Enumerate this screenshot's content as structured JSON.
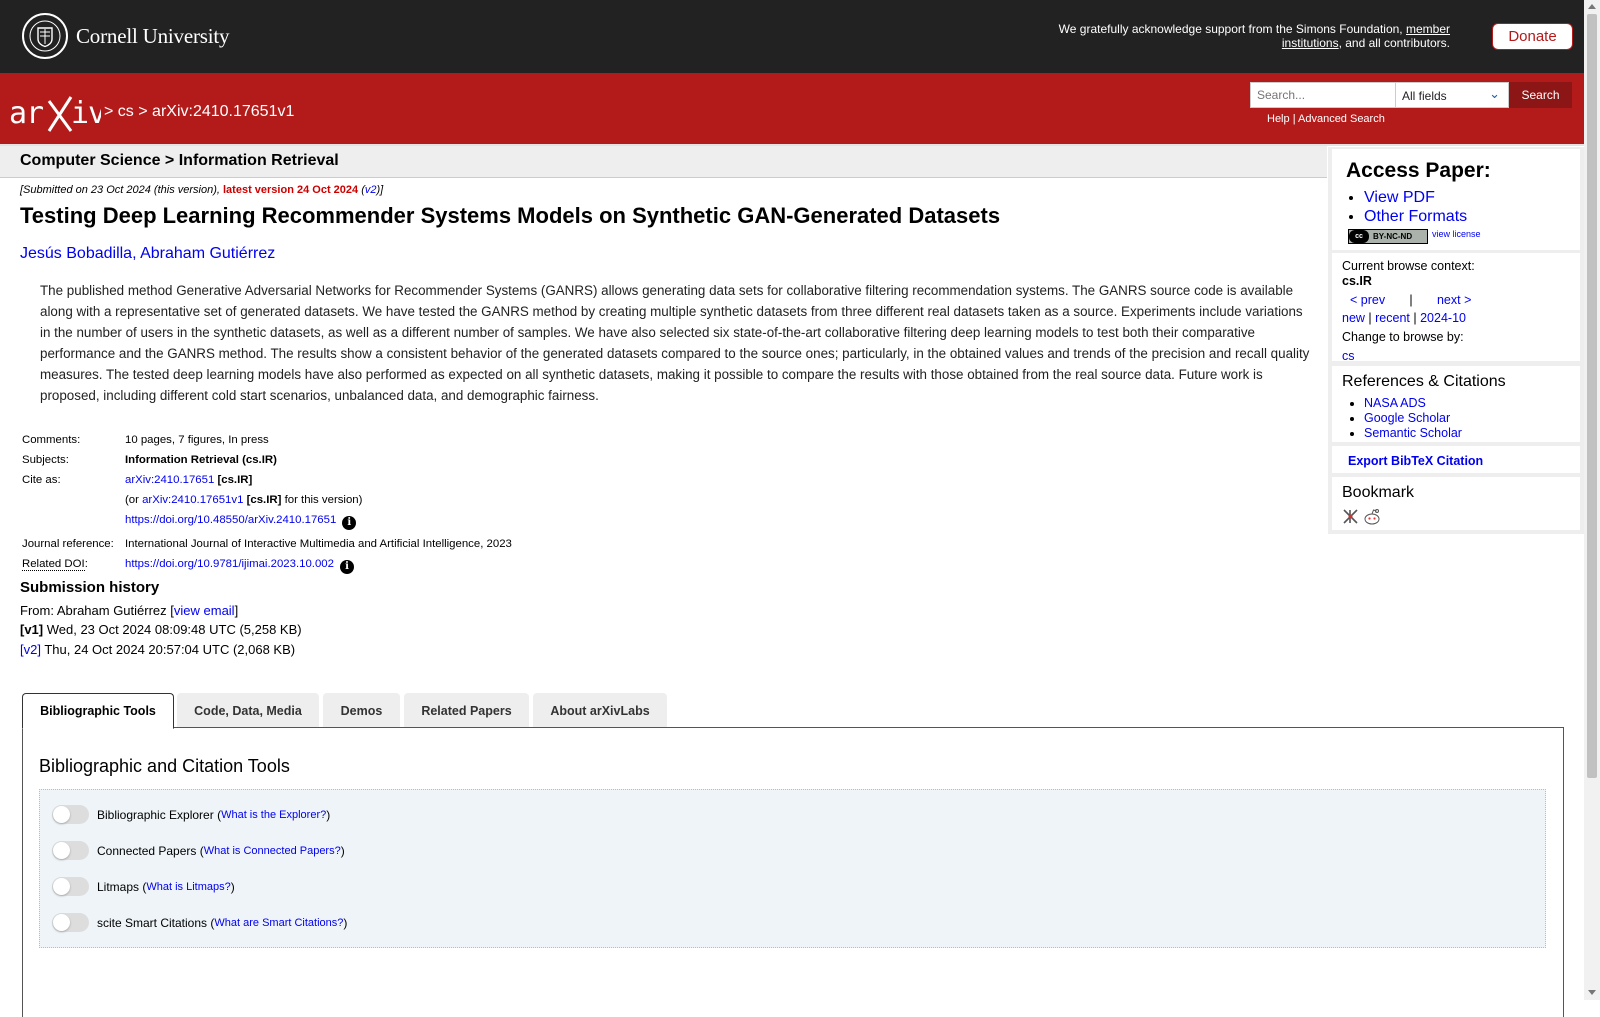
{
  "topbar": {
    "university": "Cornell University",
    "support_pre": "We gratefully acknowledge support from the Simons Foundation,",
    "support_link": "member institutions",
    "support_post": ", and all contributors.",
    "donate": "Donate"
  },
  "nav": {
    "crumb_sep": ">",
    "crumb_cs": "cs",
    "crumb_id": "arXiv:2410.17651v1",
    "search_placeholder": "Search...",
    "search_field": "All fields",
    "search_button": "Search",
    "help": "Help",
    "separator": "|",
    "advanced": "Advanced Search"
  },
  "subheader": "Computer Science > Information Retrieval",
  "paper": {
    "dateline_pre": "[Submitted on 23 Oct 2024 (this version), ",
    "dateline_latest": "latest version 24 Oct 2024",
    "dateline_v2": "v2",
    "title": "Testing Deep Learning Recommender Systems Models on Synthetic GAN-Generated Datasets",
    "author1": "Jesús Bobadilla",
    "author2": "Abraham Gutiérrez",
    "abstract": "The published method Generative Adversarial Networks for Recommender Systems (GANRS) allows generating data sets for collaborative filtering recommendation systems. The GANRS source code is available along with a representative set of generated datasets. We have tested the GANRS method by creating multiple synthetic datasets from three different real datasets taken as a source. Experiments include variations in the number of users in the synthetic datasets, as well as a different number of samples. We have also selected six state-of-the-art collaborative filtering deep learning models to test both their comparative performance and the GANRS method. The results show a consistent behavior of the generated datasets compared to the source ones; particularly, in the obtained values and trends of the precision and recall quality measures. The tested deep learning models have also performed as expected on all synthetic datasets, making it possible to compare the results with those obtained from the real source data. Future work is proposed, including different cold start scenarios, unbalanced data, and demographic fairness."
  },
  "meta": {
    "comments_label": "Comments:",
    "comments": "10 pages, 7 figures, In press",
    "subjects_label": "Subjects:",
    "subjects": "Information Retrieval (cs.IR)",
    "cite_label": "Cite as:",
    "cite_id": "arXiv:2410.17651",
    "cite_cat": "[cs.IR]",
    "cite_or": "(or ",
    "cite_v1": "arXiv:2410.17651v1",
    "cite_this": " for this version)",
    "doi": "https://doi.org/10.48550/arXiv.2410.17651",
    "journal_label": "Journal reference:",
    "journal": "International Journal of Interactive Multimedia and Artificial Intelligence, 2023",
    "related_label": "Related DOI",
    "related_doi": "https://doi.org/10.9781/ijimai.2023.10.002",
    "info": "i"
  },
  "history": {
    "heading": "Submission history",
    "from_pre": "From: Abraham Gutiérrez [",
    "view_email": "view email",
    "v1_tag": "[v1]",
    "v1": " Wed, 23 Oct 2024 08:09:48 UTC (5,258 KB)",
    "v2_tag": "[v2]",
    "v2": " Thu, 24 Oct 2024 20:57:04 UTC (2,068 KB)"
  },
  "tabs": [
    "Bibliographic Tools",
    "Code, Data, Media",
    "Demos",
    "Related Papers",
    "About arXivLabs"
  ],
  "tools": {
    "title": "Bibliographic and Citation Tools",
    "rows": [
      {
        "label": "Bibliographic Explorer",
        "link": "What is the Explorer?"
      },
      {
        "label": "Connected Papers",
        "link": "What is Connected Papers?"
      },
      {
        "label": "Litmaps",
        "link": "What is Litmaps?"
      },
      {
        "label": "scite Smart Citations",
        "link": "What are Smart Citations?"
      }
    ]
  },
  "sidebar": {
    "access_title": "Access Paper:",
    "view_pdf": "View PDF",
    "other_formats": "Other Formats",
    "license_badge": "BY-NC-ND",
    "license_cc": "cc",
    "view_license": "view license",
    "context_label": "Current browse context:",
    "context": "cs.IR",
    "prev": "< prev",
    "next": "next >",
    "new": "new",
    "recent": "recent",
    "month": "2024-10",
    "change_label": "Change to browse by:",
    "change_cs": "cs",
    "refs_title": "References & Citations",
    "refs": [
      "NASA ADS",
      "Google Scholar",
      "Semantic Scholar"
    ],
    "bibtex": "Export BibTeX Citation",
    "bookmark": "Bookmark"
  },
  "colors": {
    "arxiv_red": "#b31b1b",
    "topbar": "#222222",
    "link": "#0000ee"
  }
}
